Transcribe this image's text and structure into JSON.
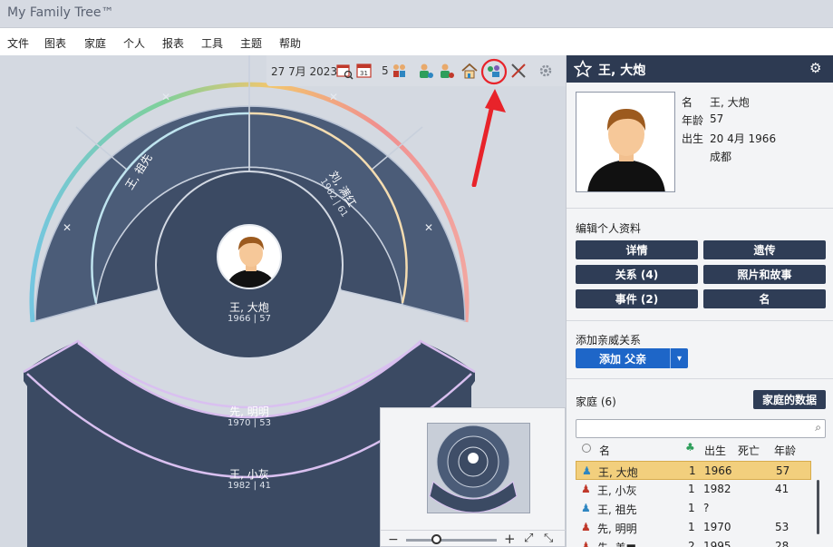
{
  "app": {
    "title": "My Family Tree™"
  },
  "menu": [
    "文件",
    "图表",
    "家庭",
    "个人",
    "报表",
    "工具",
    "主题",
    "帮助"
  ],
  "toolbar": {
    "date": "27 7月 2023",
    "count": "5"
  },
  "fan": {
    "center": {
      "name": "王, 大炮",
      "years": "1966 | 57"
    },
    "father": {
      "name": "王, 祖先"
    },
    "mother": {
      "name": "刘, 满红",
      "years": "1962 | 61"
    },
    "spouse": {
      "name": "先, 明明",
      "years": "1970 | 53"
    },
    "child": {
      "name": "王, 小灰",
      "years": "1982 | 41"
    },
    "placeholder": "✕"
  },
  "panel": {
    "name": "王, 大炮",
    "labels": {
      "name": "名",
      "age": "年龄",
      "birth": "出生"
    },
    "values": {
      "name": "王, 大炮",
      "age": "57",
      "birth_date": "20 4月 1966",
      "birth_place": "成都"
    },
    "edit_title": "编辑个人资料",
    "buttons": [
      "详情",
      "遗传",
      "关系 (4)",
      "照片和故事",
      "事件 (2)",
      "名"
    ],
    "add_title": "添加亲威关系",
    "add_button": "添加 父亲",
    "family_title": "家庭 (6)",
    "family_data_button": "家庭的数据",
    "search_placeholder": "",
    "columns": [
      "名",
      "出生",
      "死亡",
      "年龄"
    ],
    "rows": [
      {
        "name": "王, 大炮",
        "flag": "1",
        "birth": "1966",
        "death": "",
        "age": "57",
        "gender": "male"
      },
      {
        "name": "王, 小灰",
        "flag": "1",
        "birth": "1982",
        "death": "",
        "age": "41",
        "gender": "female"
      },
      {
        "name": "王, 祖先",
        "flag": "1",
        "birth": "?",
        "death": "",
        "age": "",
        "gender": "male"
      },
      {
        "name": "先, 明明",
        "flag": "1",
        "birth": "1970",
        "death": "",
        "age": "53",
        "gender": "female"
      },
      {
        "name": "先, 美■",
        "flag": "2",
        "birth": "1995",
        "death": "",
        "age": "28",
        "gender": "female"
      }
    ]
  },
  "colors": {
    "wedge": "#4e5f7b",
    "wedge_dark": "#3b4a63",
    "header": "#2d3a52",
    "annotation": "#e8232a",
    "selected": "#f2cf7d"
  }
}
